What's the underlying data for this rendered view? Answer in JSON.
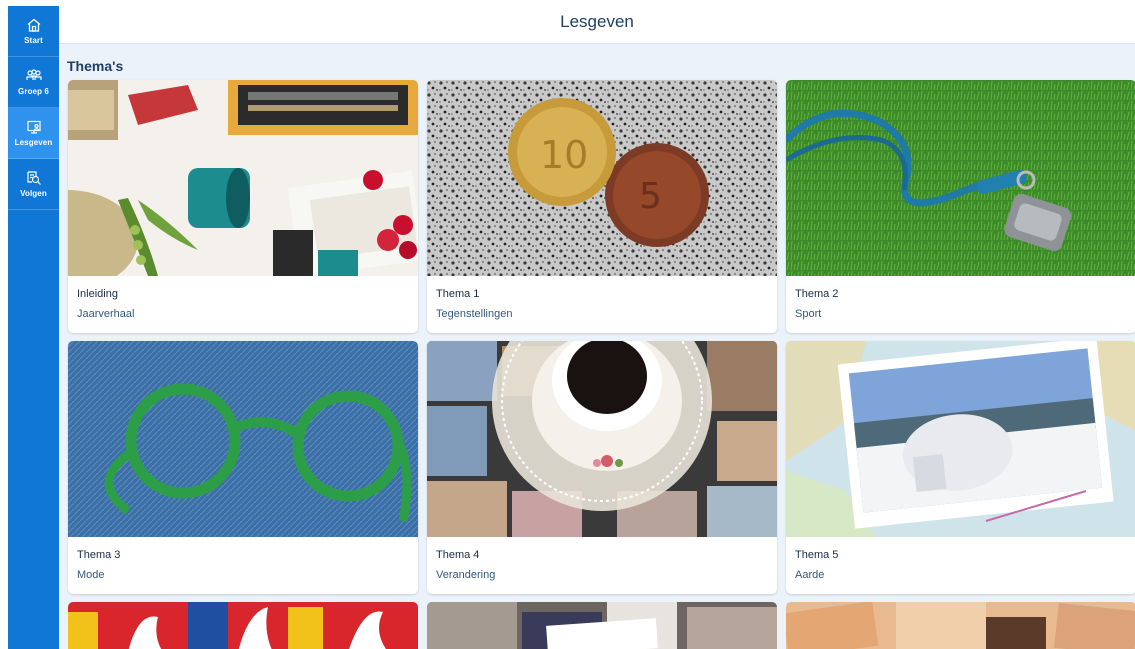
{
  "sidebar": {
    "items": [
      {
        "label": "Start",
        "icon": "home-icon",
        "active": false
      },
      {
        "label": "Groep 6",
        "icon": "group-icon",
        "active": false
      },
      {
        "label": "Lesgeven",
        "icon": "teach-board-icon",
        "active": true
      },
      {
        "label": "Volgen",
        "icon": "follow-search-icon",
        "active": false
      }
    ]
  },
  "header": {
    "title": "Lesgeven"
  },
  "main": {
    "section_title": "Thema's",
    "cards": [
      {
        "title": "Inleiding",
        "subtitle": "Jaarverhaal"
      },
      {
        "title": "Thema 1",
        "subtitle": "Tegenstellingen"
      },
      {
        "title": "Thema 2",
        "subtitle": "Sport"
      },
      {
        "title": "Thema 3",
        "subtitle": "Mode"
      },
      {
        "title": "Thema 4",
        "subtitle": "Verandering"
      },
      {
        "title": "Thema 5",
        "subtitle": "Aarde"
      }
    ]
  },
  "colors": {
    "sidebar": "#1177d6",
    "sidebar_active": "#2f92ee",
    "background": "#ecf2f9",
    "title": "#1f3f63"
  }
}
